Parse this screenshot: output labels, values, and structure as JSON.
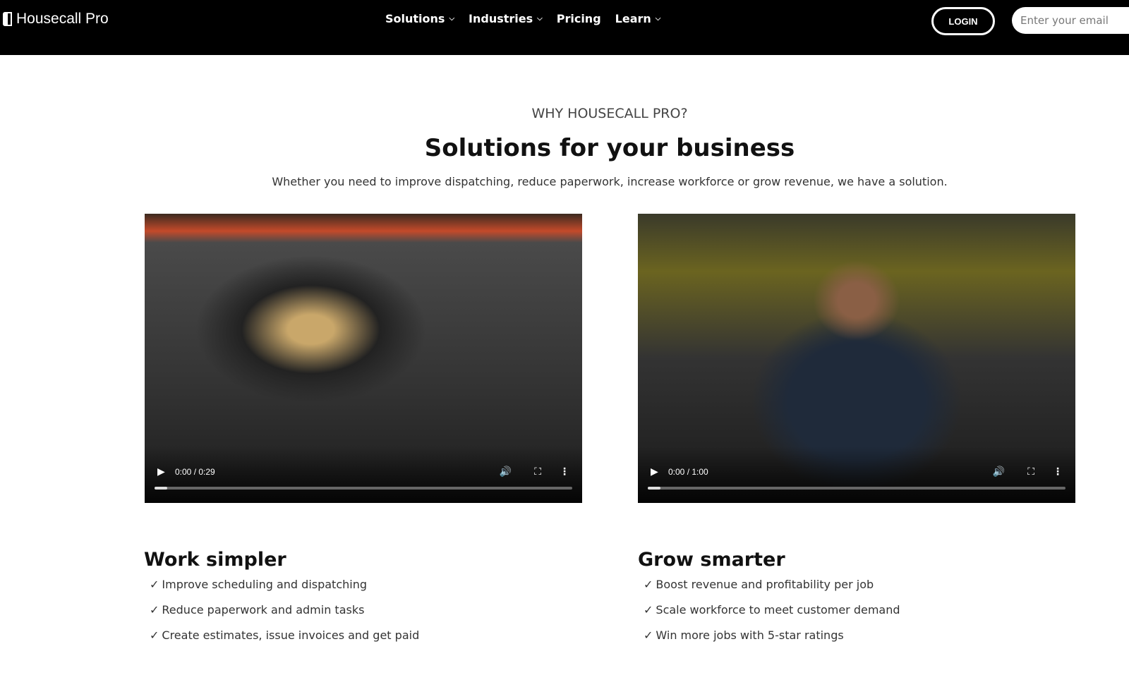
{
  "nav": {
    "logo": "Housecall Pro",
    "menu": [
      {
        "label": "Solutions",
        "dropdown": true
      },
      {
        "label": "Industries",
        "dropdown": true
      },
      {
        "label": "Pricing",
        "dropdown": false
      },
      {
        "label": "Learn",
        "dropdown": true
      }
    ],
    "login": "LOGIN",
    "email_placeholder": "Enter your email"
  },
  "hero": {
    "eyebrow": "WHY HOUSECALL PRO?",
    "title": "Solutions for your business",
    "subtitle": "Whether you need to improve dispatching, reduce paperwork, increase workforce or grow revenue, we have a solution."
  },
  "videos": [
    {
      "time": "0:00 / 0:29",
      "progress": 0.03
    },
    {
      "time": "0:00 / 1:00",
      "progress": 0.03
    }
  ],
  "columns": [
    {
      "heading": "Work simpler",
      "items": [
        "Improve scheduling and dispatching",
        "Reduce paperwork and admin tasks",
        "Create estimates, issue invoices and get paid"
      ]
    },
    {
      "heading": "Grow smarter",
      "items": [
        "Boost revenue and profitability per job",
        "Scale workforce to meet customer demand",
        "Win more jobs with 5-star ratings"
      ]
    }
  ]
}
